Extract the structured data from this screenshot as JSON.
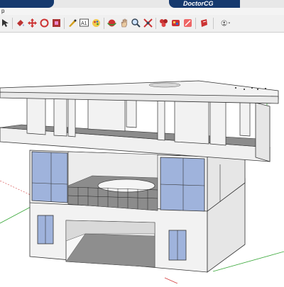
{
  "window": {
    "brand_left": "",
    "brand_right": "DoctorCG"
  },
  "menu": {
    "fragment": "p"
  },
  "toolbar": {
    "icons": [
      "select-tool-icon",
      "paint-bucket-icon",
      "move-icon",
      "rotate-icon",
      "scale-icon",
      "tape-measure-icon",
      "text-tool-icon",
      "paint-icon",
      "orbit-icon",
      "pan-icon",
      "zoom-icon",
      "zoom-extents-icon",
      "components-icon",
      "materials-icon",
      "styles-icon",
      "section-plane-icon",
      "user-account-icon"
    ]
  },
  "colors": {
    "brand": "#163a6e",
    "glass": "#9fb3dc",
    "wall": "#f2f2f2",
    "floor": "#8c8c8c",
    "axis_red": "#d23b3b",
    "axis_green": "#3aa83a"
  }
}
